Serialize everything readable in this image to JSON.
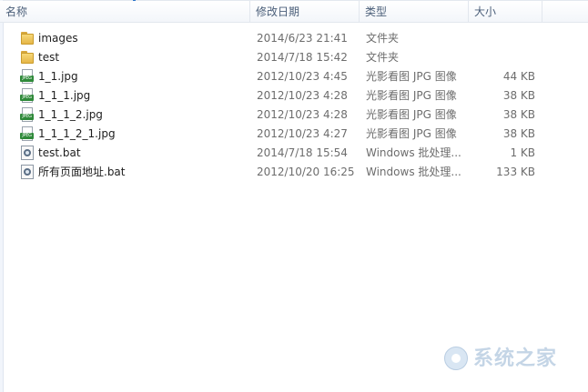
{
  "columns": {
    "name": "名称",
    "date": "修改日期",
    "type": "类型",
    "size": "大小"
  },
  "files": [
    {
      "name": "images",
      "date": "2014/6/23 21:41",
      "type": "文件夹",
      "size": "",
      "icon": "folder-icon"
    },
    {
      "name": "test",
      "date": "2014/7/18 15:42",
      "type": "文件夹",
      "size": "",
      "icon": "folder-icon"
    },
    {
      "name": "1_1.jpg",
      "date": "2012/10/23 4:45",
      "type": "光影看图 JPG 图像",
      "size": "44 KB",
      "icon": "jpeg-icon"
    },
    {
      "name": "1_1_1.jpg",
      "date": "2012/10/23 4:28",
      "type": "光影看图 JPG 图像",
      "size": "38 KB",
      "icon": "jpeg-icon"
    },
    {
      "name": "1_1_1_2.jpg",
      "date": "2012/10/23 4:28",
      "type": "光影看图 JPG 图像",
      "size": "38 KB",
      "icon": "jpeg-icon"
    },
    {
      "name": "1_1_1_2_1.jpg",
      "date": "2012/10/23 4:27",
      "type": "光影看图 JPG 图像",
      "size": "38 KB",
      "icon": "jpeg-icon"
    },
    {
      "name": "test.bat",
      "date": "2014/7/18 15:54",
      "type": "Windows 批处理...",
      "size": "1 KB",
      "icon": "bat-icon"
    },
    {
      "name": "所有页面地址.bat",
      "date": "2012/10/20 16:25",
      "type": "Windows 批处理...",
      "size": "133 KB",
      "icon": "bat-icon"
    }
  ],
  "icon_labels": {
    "jpeg": "JPEG"
  },
  "watermark": {
    "text": "系统之家"
  }
}
